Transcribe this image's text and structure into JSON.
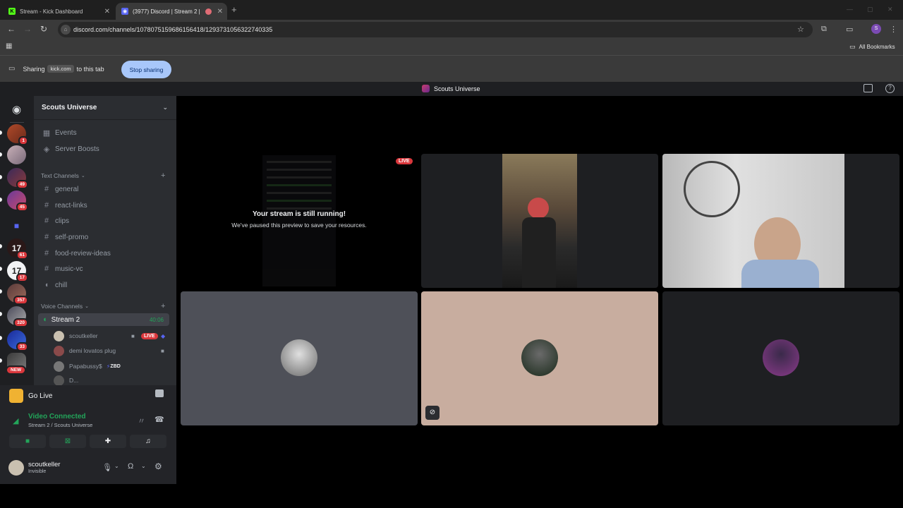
{
  "browser": {
    "tabs": [
      {
        "title": "Stream - Kick Dashboard",
        "favicon": "kick-icon"
      },
      {
        "title": "(3977) Discord | Stream 2 |",
        "favicon": "discord-icon"
      }
    ],
    "url": "discord.com/channels/1078075159686156418/1293731056322740335",
    "bookmarks_label": "All Bookmarks",
    "profile_initial": "S"
  },
  "sharing": {
    "prefix": "Sharing",
    "site": "kick.com",
    "suffix": "to this tab",
    "stop_label": "Stop sharing"
  },
  "discord": {
    "window_title": "Scouts Universe",
    "guild_badges": [
      "1",
      "49",
      "45",
      "61",
      "17",
      "357",
      "320",
      "33",
      "NEW"
    ],
    "server_name": "Scouts Universe",
    "top_items": [
      {
        "label": "Events",
        "icon": "calendar-icon"
      },
      {
        "label": "Server Boosts",
        "icon": "boost-icon"
      }
    ],
    "text_category": "Text Channels",
    "text_channels": [
      "general",
      "react-links",
      "clips",
      "self-promo",
      "food-review-ideas",
      "music-vc",
      "chill"
    ],
    "voice_category": "Voice Channels",
    "voice_channel": {
      "name": "Stream 2",
      "timer": "40:06"
    },
    "voice_users": [
      {
        "name": "scoutkeller",
        "live": "LIVE"
      },
      {
        "name": "demi lovatos plug"
      },
      {
        "name": "Papabussy$",
        "tag": "ZBD"
      },
      {
        "name": "D..."
      }
    ],
    "go_live": "Go Live",
    "connection": {
      "status": "Video Connected",
      "location": "Stream 2 / Scouts Universe"
    },
    "user": {
      "name": "scoutkeller",
      "status": "Invisible"
    }
  },
  "stage": {
    "live_badge": "LIVE",
    "paused_title": "Your stream is still running!",
    "paused_sub": "We've paused this preview to save your resources."
  },
  "colors": {
    "accent": "#a8c7fa",
    "discord_green": "#23a55a",
    "live_red": "#da373c",
    "tile_gray": "#4e5058",
    "tile_tan": "#c8ad9f"
  }
}
